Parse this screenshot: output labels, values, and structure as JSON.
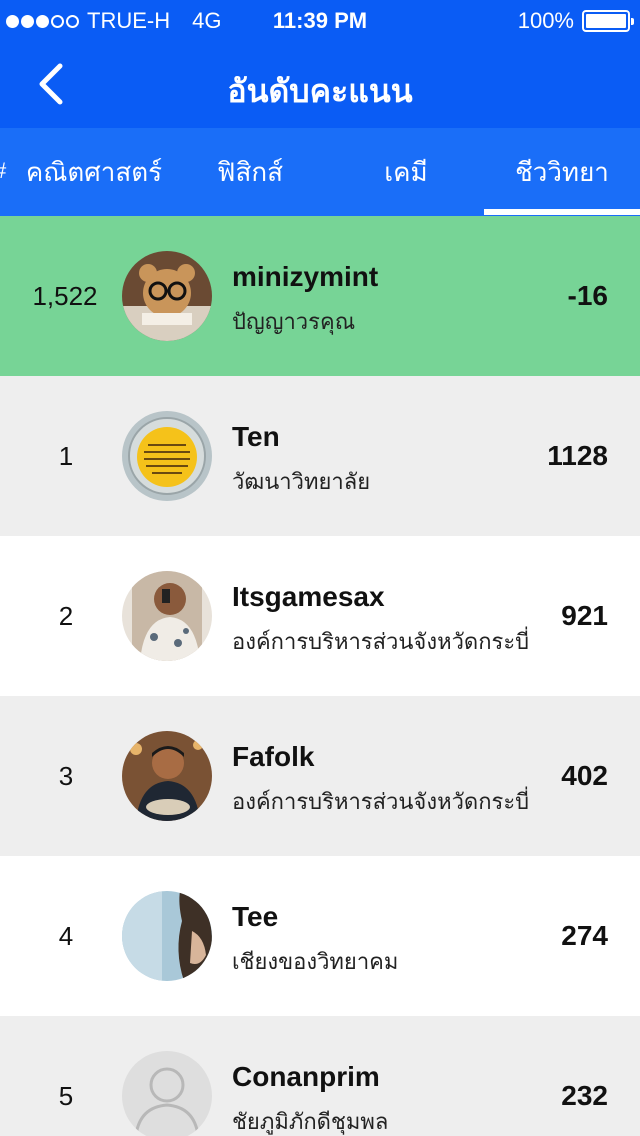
{
  "status": {
    "carrier": "TRUE-H",
    "network": "4G",
    "time": "11:39 PM",
    "battery": "100%"
  },
  "nav": {
    "title": "อันดับคะแนน",
    "back_icon": "chevron-left-icon"
  },
  "tabs": [
    {
      "label": "คณิตศาสตร์",
      "active": false
    },
    {
      "label": "ฟิสิกส์",
      "active": false
    },
    {
      "label": "เคมี",
      "active": false
    },
    {
      "label": "ชีววิทยา",
      "active": true
    }
  ],
  "me": {
    "rank": "1,522",
    "name": "minizymint",
    "school": "ปัญญาวรคุณ",
    "score": "-16"
  },
  "leaderboard": [
    {
      "rank": "1",
      "name": "Ten",
      "school": "วัฒนาวิทยาลัย",
      "score": "1128"
    },
    {
      "rank": "2",
      "name": "Itsgamesax",
      "school": "องค์การบริหารส่วนจังหวัดกระบี่",
      "score": "921"
    },
    {
      "rank": "3",
      "name": "Fafolk",
      "school": "องค์การบริหารส่วนจังหวัดกระบี่",
      "score": "402"
    },
    {
      "rank": "4",
      "name": "Tee",
      "school": "เชียงของวิทยาคม",
      "score": "274"
    },
    {
      "rank": "5",
      "name": "Conanprim",
      "school": "ชัยภูมิภักดีชุมพล",
      "score": "232"
    }
  ],
  "colors": {
    "header": "#0a5cf5",
    "tabs": "#1a6ef8",
    "highlight": "#77d496",
    "row_alt": "#eeeeee"
  }
}
